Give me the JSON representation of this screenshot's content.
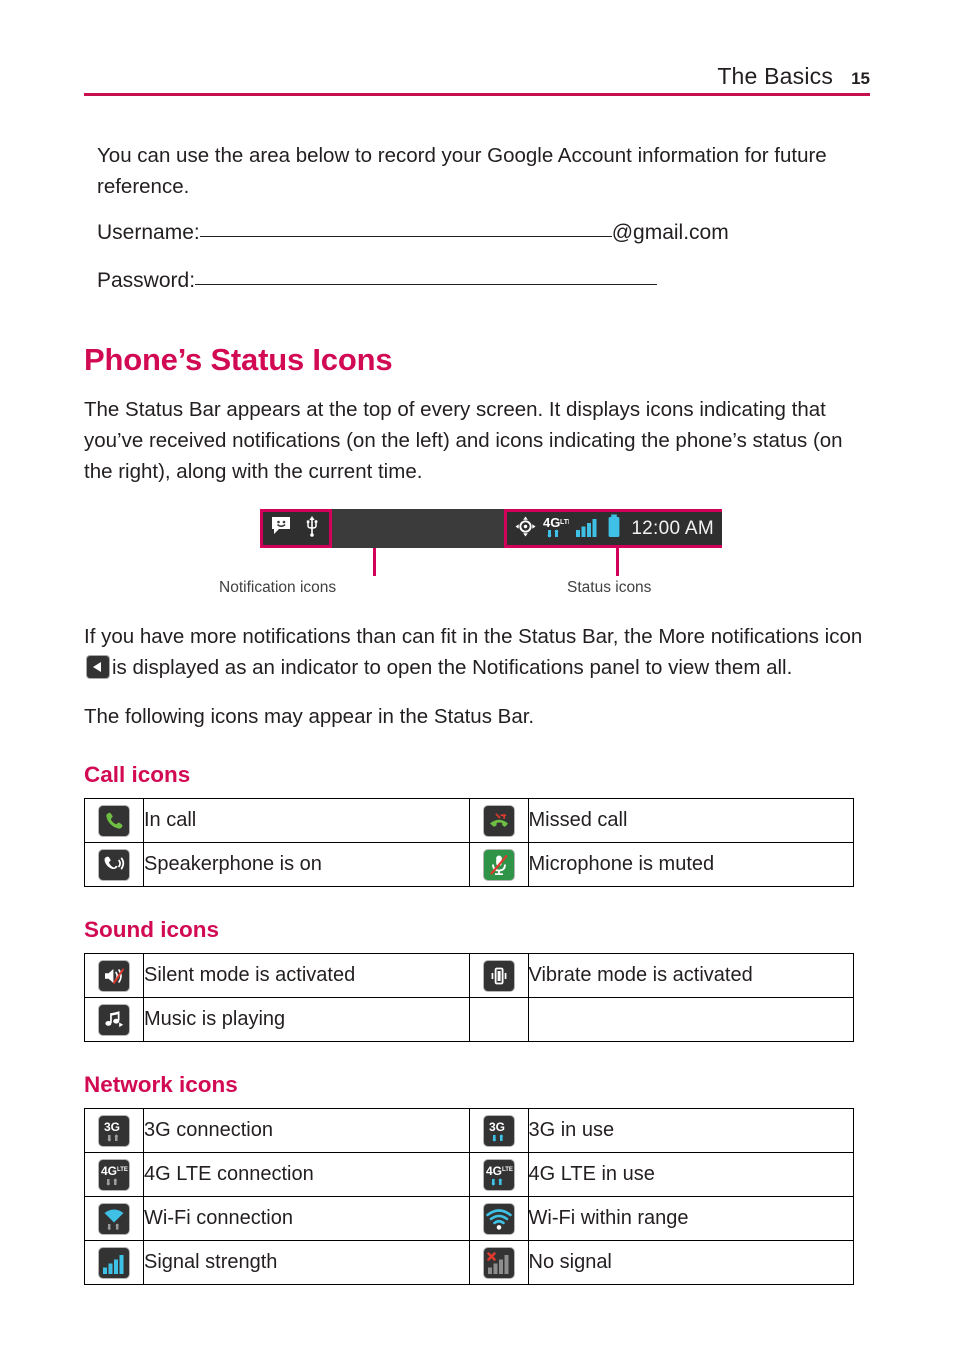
{
  "header": {
    "title": "The Basics",
    "page_number": "15"
  },
  "intro": {
    "paragraph": "You can use the area below to record your Google Account information for future reference.",
    "username_label": "Username:",
    "username_suffix": "@gmail.com",
    "password_label": "Password:"
  },
  "section": {
    "title": "Phone’s Status Icons",
    "paragraph_1": "The Status Bar appears at the top of every screen. It displays icons indicating that you’ve received notifications (on the left) and icons indicating the phone’s status (on the right), along with the current time.",
    "paragraph_2_before": "If you have more notifications than can fit in the Status Bar, the More notifications icon",
    "paragraph_2_after": "is displayed as an indicator to open the Notifications panel to view them all.",
    "paragraph_3": "The following icons may appear in the Status Bar."
  },
  "figure": {
    "notification_label": "Notification icons",
    "status_label": "Status icons",
    "time": "12:00 AM",
    "notification_icons": [
      "message-bubble-icon",
      "usb-icon"
    ],
    "status_icons": [
      "gps-icon",
      "4glte-icon",
      "signal-bars-icon",
      "battery-icon"
    ],
    "highlight_color": "#d2005a",
    "bar_color": "#3b3b3b",
    "accent_cyan": "#3fc0e6"
  },
  "tables": [
    {
      "heading": "Call icons",
      "rows": [
        {
          "left": {
            "icon": "in-call-icon",
            "label": "In call"
          },
          "right": {
            "icon": "missed-call-icon",
            "label": "Missed call"
          }
        },
        {
          "left": {
            "icon": "speakerphone-icon",
            "label": "Speakerphone is on"
          },
          "right": {
            "icon": "microphone-muted-icon",
            "label": "Microphone is muted"
          }
        }
      ]
    },
    {
      "heading": "Sound icons",
      "rows": [
        {
          "left": {
            "icon": "silent-mode-icon",
            "label": "Silent mode is activated"
          },
          "right": {
            "icon": "vibrate-mode-icon",
            "label": "Vibrate mode is activated"
          }
        },
        {
          "left": {
            "icon": "music-playing-icon",
            "label": "Music is playing"
          },
          "right": {
            "icon": "",
            "label": ""
          }
        }
      ]
    },
    {
      "heading": "Network icons",
      "rows": [
        {
          "left": {
            "icon": "3g-connection-icon",
            "label": "3G connection"
          },
          "right": {
            "icon": "3g-in-use-icon",
            "label": "3G in use"
          }
        },
        {
          "left": {
            "icon": "4glte-connection-icon",
            "label": "4G LTE connection"
          },
          "right": {
            "icon": "4glte-in-use-icon",
            "label": "4G LTE in use"
          }
        },
        {
          "left": {
            "icon": "wifi-connection-icon",
            "label": "Wi-Fi connection"
          },
          "right": {
            "icon": "wifi-in-range-icon",
            "label": "Wi-Fi within range"
          }
        },
        {
          "left": {
            "icon": "signal-strength-icon",
            "label": "Signal strength"
          },
          "right": {
            "icon": "no-signal-icon",
            "label": "No signal"
          }
        }
      ]
    }
  ],
  "colors": {
    "accent_magenta": "#d2005a",
    "heading_magenta": "#d20a53",
    "text": "#231f20",
    "tile_dark": "#333333",
    "tile_green": "#2f9447",
    "cyan": "#3fc0e6",
    "green": "#6fbe44",
    "red": "#e03a2f"
  }
}
